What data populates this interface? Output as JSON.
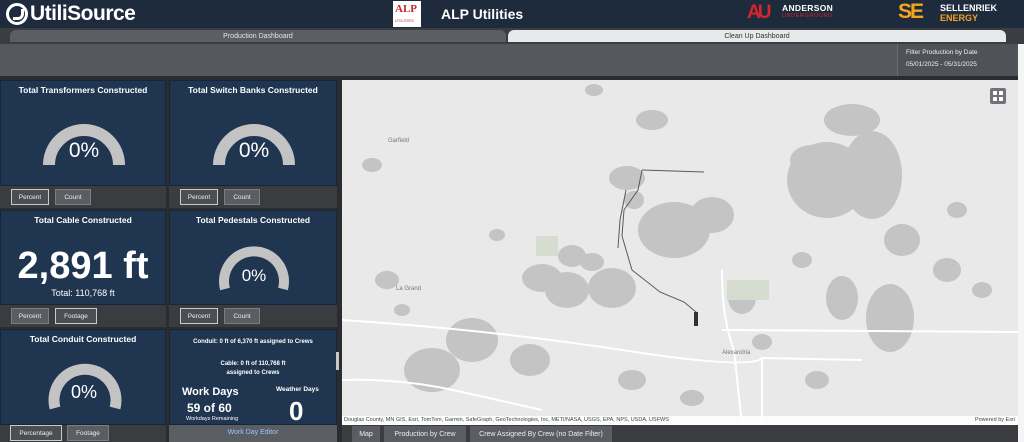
{
  "header": {
    "utili_logo": "UtiliSource",
    "alp_logo": "ALP",
    "alp_logo_sub": "UTILITIES",
    "title": "ALP Utilities",
    "au_mark": "AU",
    "au_name": "ANDERSON",
    "au_sub": "UNDERGROUND",
    "se_mark": "SE",
    "se_name": "SELLENRIEK",
    "se_sub": "ENERGY"
  },
  "tabs": [
    {
      "label": "Production Dashboard",
      "active": true
    },
    {
      "label": "Clean Up Dashboard",
      "active": false
    }
  ],
  "filter": {
    "title": "Filter Production by Date",
    "range": "05/01/2025 - 05/31/2025"
  },
  "widgets": {
    "transformers": {
      "title": "Total Transformers Constructed",
      "value": "0%",
      "percent": 0,
      "buttons": [
        "Percent",
        "Count"
      ]
    },
    "switch_banks": {
      "title": "Total Switch Banks Constructed",
      "value": "0%",
      "percent": 0,
      "buttons": [
        "Percent",
        "Count"
      ]
    },
    "cable": {
      "title": "Total Cable Constructed",
      "value": "2,891 ft",
      "total": "Total: 110,768 ft",
      "buttons": [
        "Percent",
        "Footage"
      ]
    },
    "pedestals": {
      "title": "Total Pedestals Constructed",
      "value": "0%",
      "percent": 0,
      "buttons": [
        "Percent",
        "Count"
      ]
    },
    "conduit": {
      "title": "Total Conduit Constructed",
      "value": "0%",
      "percent": 0,
      "buttons": [
        "Percentage",
        "Footage"
      ]
    },
    "workdays": {
      "conduit_line": "Conduit: 0 ft of 6,370 ft assigned to Crews",
      "cable_line1": "Cable: 0 ft of 110,768 ft",
      "cable_line2": "assigned to Crews",
      "work_days_label": "Work Days",
      "work_days_value": "59 of 60",
      "remaining": "Workdays Remaining",
      "weather_label": "Weather Days",
      "weather_value": "0",
      "editor_link": "Work Day Editor"
    }
  },
  "map": {
    "places": [
      "Garfield",
      "La Grand",
      "Alexandria"
    ],
    "attribution": "Douglas County, MN GIS, Esri, TomTom, Garmin, SafeGraph, GeoTechnologies, Inc, METI/NASA, USGS, EPA, NPS, USDA, USFWS",
    "powered": "Powered by Esri",
    "tabs": [
      "Map",
      "Production by Crew",
      "Crew Assigned By Crew (no Date Filter)"
    ]
  },
  "colors": {
    "header": "#1e2b3d",
    "panel": "#1f3550",
    "gauge_track": "#c3c3c3",
    "map_bg": "#e9e9e9",
    "water": "#c4c4c4"
  }
}
